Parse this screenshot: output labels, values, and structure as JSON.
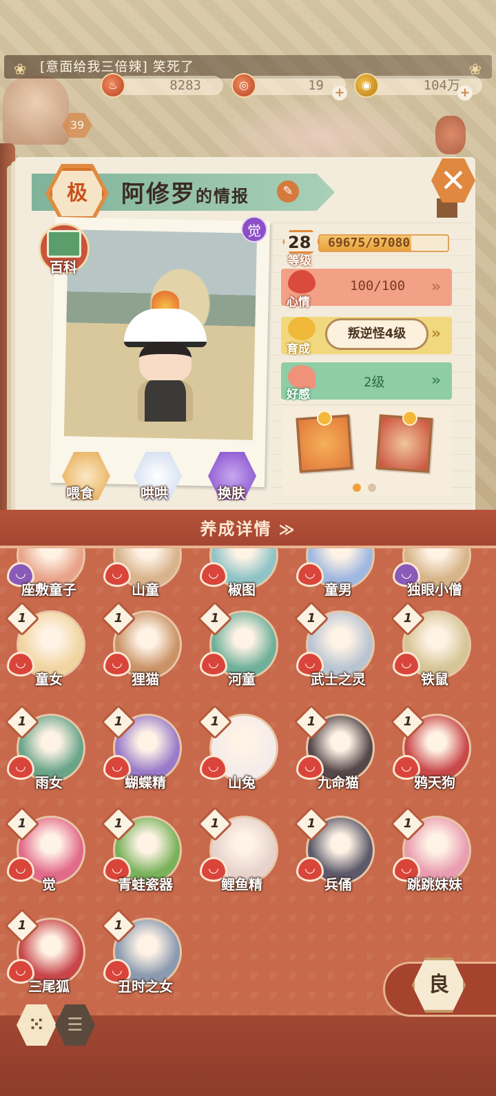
{
  "top": {
    "marquee_text": "[意面给我三倍辣] 笑死了",
    "flower_icon": "flower-icon",
    "resources": [
      {
        "name": "stamina",
        "value": "8283",
        "icon": "stamina-icon"
      },
      {
        "name": "jade",
        "value": "19",
        "icon": "jade-icon"
      },
      {
        "name": "coin",
        "value": "104万",
        "icon": "coin-icon"
      }
    ],
    "player_level": "39"
  },
  "panel": {
    "rank": "极",
    "title_name": "阿修罗",
    "title_suffix": "的情报",
    "edit_icon": "✎",
    "close_icon": "✕",
    "awaken_badge": "觉",
    "encyclopedia_label": "百科",
    "actions": {
      "feed": "喂食",
      "pet": "哄哄",
      "skin": "换肤"
    },
    "level": {
      "value": "28",
      "label": "等级",
      "exp_text": "69675/97080",
      "exp_current": 69675,
      "exp_max": 97080
    },
    "mood": {
      "label": "心情",
      "value": "100/100",
      "arrow": "»"
    },
    "growth": {
      "label": "育成",
      "value": "叛逆怪4级",
      "arrow": "»"
    },
    "favor": {
      "label": "好感",
      "value": "2级",
      "arrow": "»"
    },
    "gift_pages": {
      "active": 0,
      "count": 2
    },
    "colors": {
      "accent": "#e0883f",
      "mood": "#f2a086",
      "growth": "#f1d77e",
      "favor": "#8fcda6"
    }
  },
  "section": {
    "title": "养成详情",
    "chevron": "≫"
  },
  "shikigami": [
    {
      "name": "座敷童子",
      "star": "",
      "heart": "purple",
      "portrait": "#e9a38a"
    },
    {
      "name": "山童",
      "star": "",
      "heart": "red",
      "portrait": "#d8b38c"
    },
    {
      "name": "椒图",
      "star": "",
      "heart": "red",
      "portrait": "#8fc4c7"
    },
    {
      "name": "童男",
      "star": "",
      "heart": "red",
      "portrait": "#9fb8e0"
    },
    {
      "name": "独眼小僧",
      "star": "",
      "heart": "purple",
      "portrait": "#d7b58a"
    },
    {
      "name": "童女",
      "star": "1",
      "heart": "red",
      "portrait": "#f1d5a0"
    },
    {
      "name": "狸猫",
      "star": "1",
      "heart": "red",
      "portrait": "#c99366"
    },
    {
      "name": "河童",
      "star": "1",
      "heart": "red",
      "portrait": "#6fb09a"
    },
    {
      "name": "武士之灵",
      "star": "1",
      "heart": "red",
      "portrait": "#b9c4d2"
    },
    {
      "name": "铁鼠",
      "star": "1",
      "heart": "red",
      "portrait": "#d6c596"
    },
    {
      "name": "雨女",
      "star": "1",
      "heart": "red",
      "portrait": "#6aa58a"
    },
    {
      "name": "蝴蝶精",
      "star": "1",
      "heart": "red",
      "portrait": "#9a7bc9"
    },
    {
      "name": "山兔",
      "star": "1",
      "heart": "red",
      "portrait": "#f4ecea"
    },
    {
      "name": "九命猫",
      "star": "1",
      "heart": "red",
      "portrait": "#55484a"
    },
    {
      "name": "鸦天狗",
      "star": "1",
      "heart": "red",
      "portrait": "#c9494a"
    },
    {
      "name": "觉",
      "star": "1",
      "heart": "red",
      "portrait": "#e26a8a"
    },
    {
      "name": "青蛙瓷器",
      "star": "1",
      "heart": "red",
      "portrait": "#79b25a"
    },
    {
      "name": "鲤鱼精",
      "star": "1",
      "heart": "red",
      "portrait": "#e7d3cc"
    },
    {
      "name": "兵俑",
      "star": "1",
      "heart": "red",
      "portrait": "#5c5a6a"
    },
    {
      "name": "跳跳妹妹",
      "star": "1",
      "heart": "red",
      "portrait": "#e89db0"
    },
    {
      "name": "三尾狐",
      "star": "1",
      "heart": "red",
      "portrait": "#c8464a"
    },
    {
      "name": "丑时之女",
      "star": "1",
      "heart": "red",
      "portrait": "#8a9ab0"
    }
  ],
  "bottom": {
    "rarity_button": "良",
    "grid_view_icon": "⁙",
    "list_view_icon": "☰"
  }
}
